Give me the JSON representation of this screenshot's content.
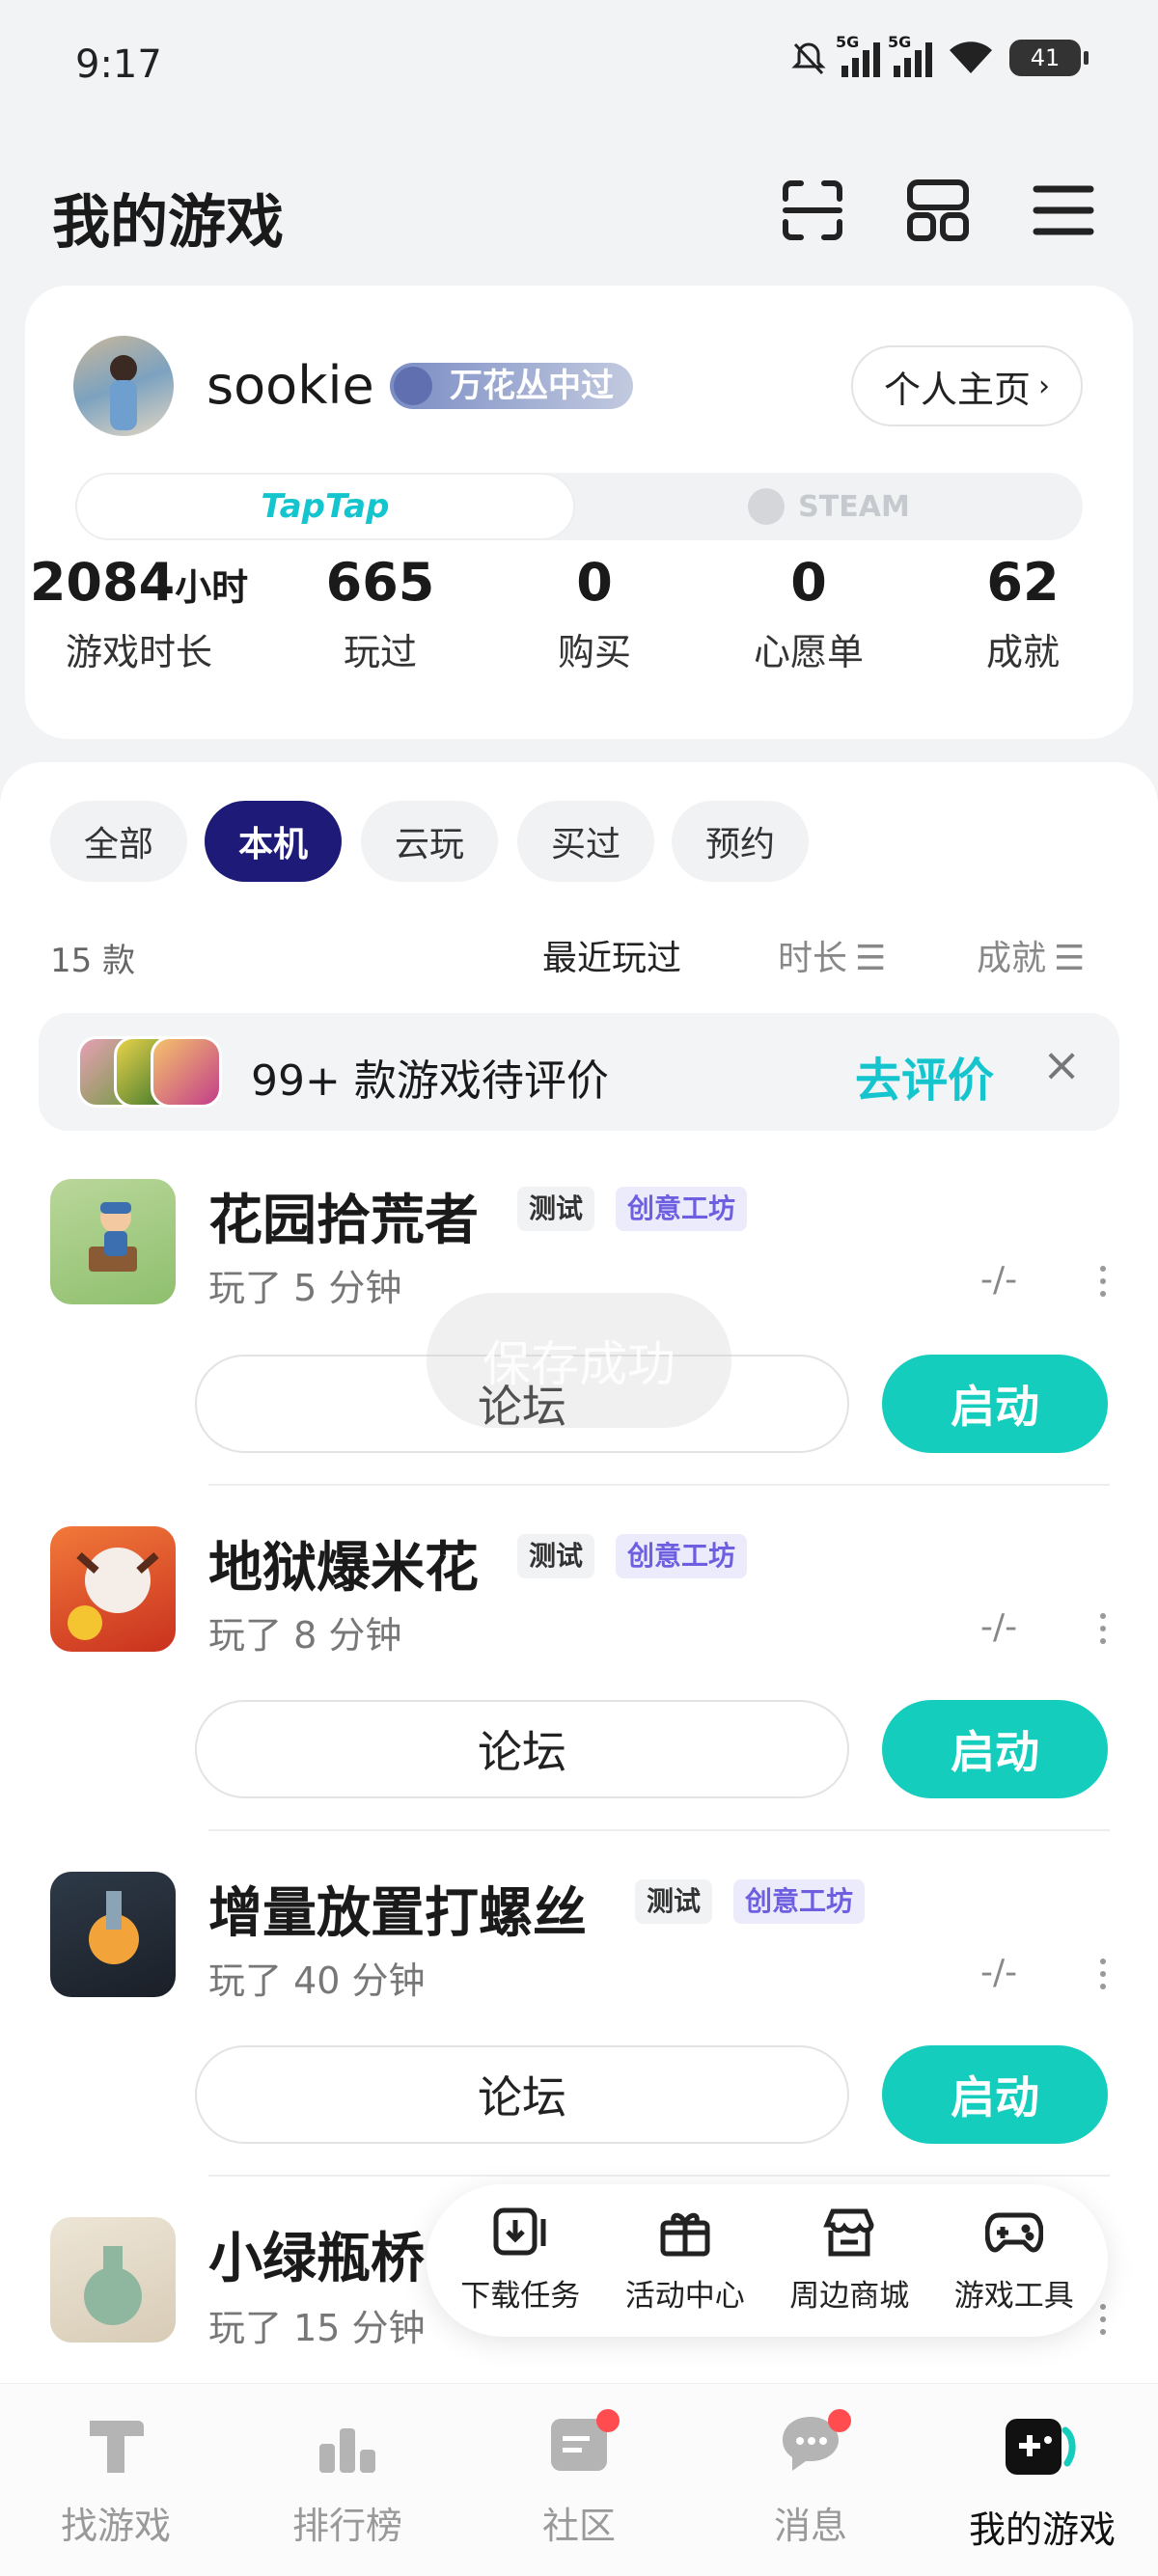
{
  "status": {
    "time": "9:17",
    "net1": "5G",
    "net2": "5G",
    "battery": "41"
  },
  "header": {
    "title": "我的游戏"
  },
  "profile": {
    "username": "sookie",
    "badge": "万花丛中过",
    "home_button": "个人主页",
    "platform_active": "TapTap",
    "platform_other": "STEAM",
    "stats": [
      {
        "value": "2084",
        "unit": "小时",
        "label": "游戏时长"
      },
      {
        "value": "665",
        "label": "玩过"
      },
      {
        "value": "0",
        "label": "购买"
      },
      {
        "value": "0",
        "label": "心愿单"
      },
      {
        "value": "62",
        "label": "成就"
      }
    ]
  },
  "filters": [
    "全部",
    "本机",
    "云玩",
    "买过",
    "预约"
  ],
  "list": {
    "count": "15 款",
    "sort_recent": "最近玩过",
    "sort_duration": "时长",
    "sort_achievements": "成就"
  },
  "review_banner": {
    "text": "99+ 款游戏待评价",
    "action": "去评价"
  },
  "games": [
    {
      "title": "花园拾荒者",
      "tag_test": "测试",
      "tag_workshop": "创意工坊",
      "played": "玩了 5 分钟",
      "rating": "-/-",
      "forum": "论坛",
      "launch": "启动"
    },
    {
      "title": "地狱爆米花",
      "tag_test": "测试",
      "tag_workshop": "创意工坊",
      "played": "玩了 8 分钟",
      "rating": "-/-",
      "forum": "论坛",
      "launch": "启动"
    },
    {
      "title": "增量放置打螺丝",
      "tag_test": "测试",
      "tag_workshop": "创意工坊",
      "played": "玩了 40 分钟",
      "rating": "-/-",
      "forum": "论坛",
      "launch": "启动"
    },
    {
      "title": "小绿瓶桥",
      "played": "玩了 15 分钟"
    }
  ],
  "toast": "保存成功",
  "quick_actions": [
    "下载任务",
    "活动中心",
    "周边商城",
    "游戏工具"
  ],
  "nav": [
    "找游戏",
    "排行榜",
    "社区",
    "消息",
    "我的游戏"
  ],
  "colors": {
    "accent": "#15cdbd",
    "active_chip": "#1e1a78",
    "workshop": "#6d5fe0"
  }
}
